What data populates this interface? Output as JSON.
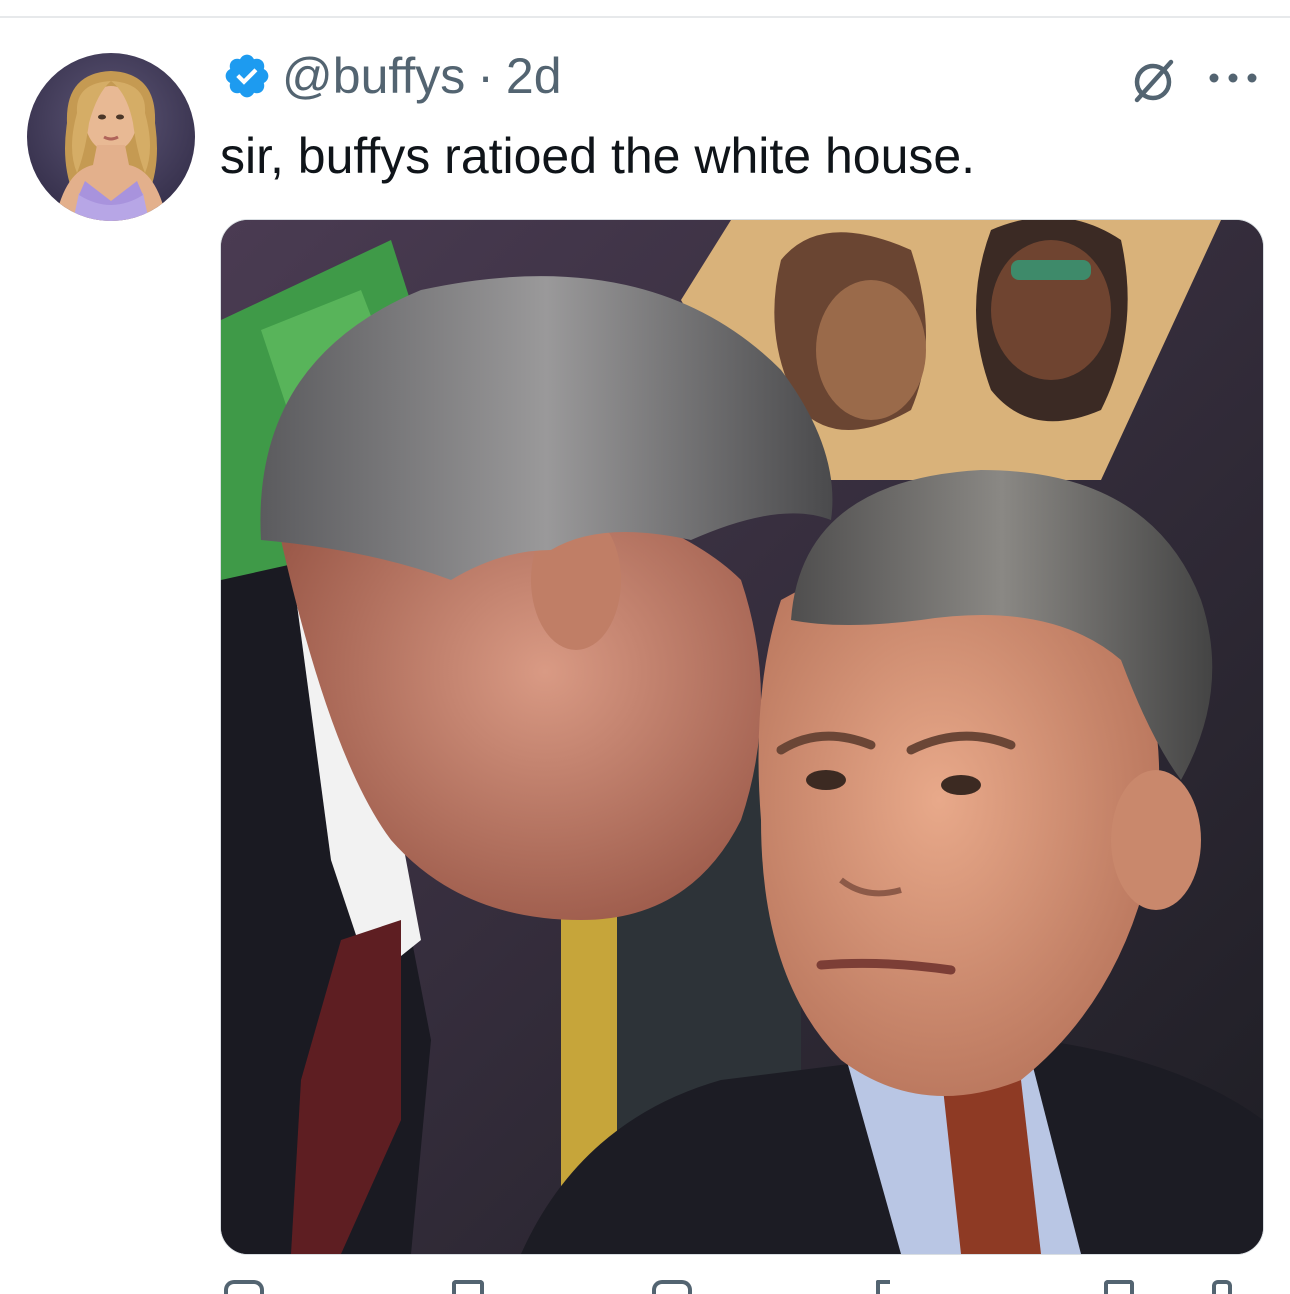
{
  "tweet": {
    "handle": "@buffys",
    "separator": "·",
    "time": "2d",
    "text": "sir, buffys ratioed the white house."
  },
  "icons": {
    "verified": "verified-badge-icon",
    "grok": "grok-icon",
    "more": "more-options-icon"
  },
  "colors": {
    "verified_blue": "#1d9bf0",
    "secondary_text": "#536471",
    "primary_text": "#0f1419"
  }
}
